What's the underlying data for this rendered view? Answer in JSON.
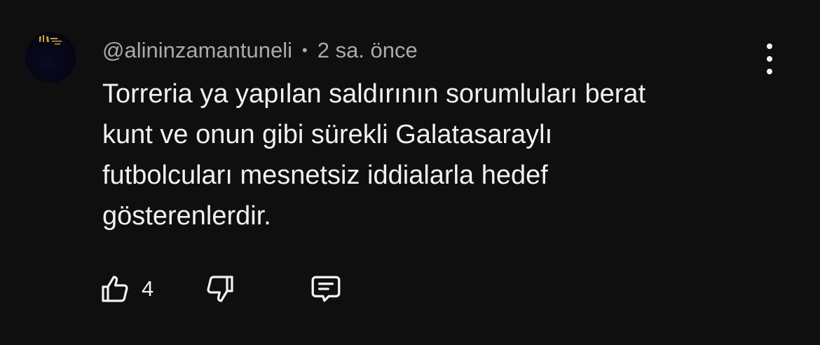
{
  "comment": {
    "author": "@alininzamantuneli",
    "separator": "•",
    "time": "2 sa. önce",
    "text": "Torreria ya yapılan saldırının sorumluları berat\nkunt ve onun gibi sürekli Galatasaraylı\nfutbolcuları mesnetsiz iddialarla hedef\ngösterenlerdir.",
    "avatar_icon": "avatar-image",
    "menu_icon": "more-vertical-icon"
  },
  "actions": {
    "like_icon": "thumbs-up-icon",
    "like_count": "4",
    "dislike_icon": "thumbs-down-icon",
    "reply_icon": "comment-icon"
  },
  "colors": {
    "background": "#0f0f0f",
    "primary_text": "#f1f1f1",
    "secondary_text": "#aaaaaa"
  }
}
